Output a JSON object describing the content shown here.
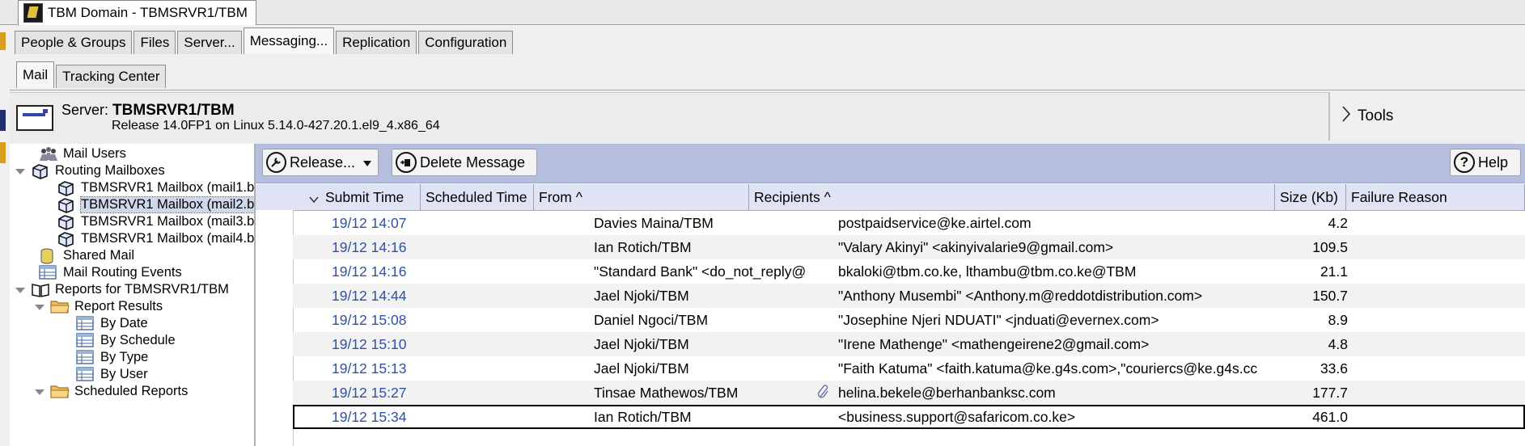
{
  "window_tab": {
    "title": "TBM Domain - TBMSRVR1/TBM"
  },
  "main_tabs": [
    {
      "label": "People & Groups",
      "active": false
    },
    {
      "label": "Files",
      "active": false
    },
    {
      "label": "Server...",
      "active": false
    },
    {
      "label": "Messaging...",
      "active": true
    },
    {
      "label": "Replication",
      "active": false
    },
    {
      "label": "Configuration",
      "active": false
    }
  ],
  "sub_tabs": [
    {
      "label": "Mail",
      "active": true
    },
    {
      "label": "Tracking Center",
      "active": false
    }
  ],
  "server": {
    "prefix": "Server:",
    "name": "TBMSRVR1/TBM",
    "release": "Release 14.0FP1 on Linux 5.14.0-427.20.1.el9_4.x86_64"
  },
  "tools": {
    "label": "Tools"
  },
  "nav": [
    {
      "label": "Mail Users",
      "icon": "users-icon",
      "twisty": "",
      "selected": false
    },
    {
      "label": "Routing Mailboxes",
      "icon": "mailbox-icon",
      "twisty": "open",
      "selected": false
    },
    {
      "label": "TBMSRVR1 Mailbox (mail1.b",
      "icon": "mailbox-icon",
      "twisty": "",
      "selected": false
    },
    {
      "label": "TBMSRVR1 Mailbox (mail2.b",
      "icon": "mailbox-icon",
      "twisty": "",
      "selected": true
    },
    {
      "label": "TBMSRVR1 Mailbox (mail3.b",
      "icon": "mailbox-icon",
      "twisty": "",
      "selected": false
    },
    {
      "label": "TBMSRVR1 Mailbox (mail4.b",
      "icon": "mailbox-icon",
      "twisty": "",
      "selected": false
    },
    {
      "label": "Shared Mail",
      "icon": "database-icon",
      "twisty": "",
      "selected": false
    },
    {
      "label": "Mail Routing Events",
      "icon": "view-icon",
      "twisty": "",
      "selected": false
    },
    {
      "label": "Reports for TBMSRVR1/TBM",
      "icon": "book-icon",
      "twisty": "open",
      "selected": false
    },
    {
      "label": "Report Results",
      "icon": "folder-icon",
      "twisty": "open",
      "selected": false
    },
    {
      "label": "By Date",
      "icon": "view-icon",
      "twisty": "",
      "selected": false
    },
    {
      "label": "By Schedule",
      "icon": "view-icon",
      "twisty": "",
      "selected": false
    },
    {
      "label": "By Type",
      "icon": "view-icon",
      "twisty": "",
      "selected": false
    },
    {
      "label": "By User",
      "icon": "view-icon",
      "twisty": "",
      "selected": false
    },
    {
      "label": "Scheduled Reports",
      "icon": "folder-icon",
      "twisty": "open",
      "selected": false
    }
  ],
  "actions": {
    "release": "Release...",
    "delete": "Delete Message",
    "help": "Help"
  },
  "columns": [
    "Submit Time",
    "Scheduled Time",
    "From ^",
    "Recipients ^",
    "Size (Kb)",
    "Failure Reason"
  ],
  "messages": [
    {
      "time": "19/12 14:07",
      "from": "Davies Maina/TBM",
      "recipients": "postpaidservice@ke.airtel.com",
      "size": "4.2",
      "attachment": false
    },
    {
      "time": "19/12 14:16",
      "from": "Ian Rotich/TBM",
      "recipients": "\"Valary Akinyi\" <akinyivalarie9@gmail.com>",
      "size": "109.5",
      "attachment": false
    },
    {
      "time": "19/12 14:16",
      "from": "\"Standard Bank\" <do_not_reply@",
      "recipients": "bkaloki@tbm.co.ke, lthambu@tbm.co.ke@TBM",
      "size": "21.1",
      "attachment": false
    },
    {
      "time": "19/12 14:44",
      "from": "Jael Njoki/TBM",
      "recipients": "\"Anthony Musembi\" <Anthony.m@reddotdistribution.com>",
      "size": "150.7",
      "attachment": false
    },
    {
      "time": "19/12 15:08",
      "from": "Daniel Ngoci/TBM",
      "recipients": "\"Josephine Njeri NDUATI\" <jnduati@evernex.com>",
      "size": "8.9",
      "attachment": false
    },
    {
      "time": "19/12 15:10",
      "from": "Jael Njoki/TBM",
      "recipients": "\"Irene Mathenge\" <mathengeirene2@gmail.com>",
      "size": "4.8",
      "attachment": false
    },
    {
      "time": "19/12 15:13",
      "from": "Jael Njoki/TBM",
      "recipients": "\"Faith Katuma\" <faith.katuma@ke.g4s.com>,\"couriercs@ke.g4s.cc",
      "size": "33.6",
      "attachment": false
    },
    {
      "time": "19/12 15:27",
      "from": "Tinsae Mathewos/TBM",
      "recipients": "helina.bekele@berhanbanksc.com",
      "size": "177.7",
      "attachment": true
    },
    {
      "time": "19/12 15:34",
      "from": "Ian Rotich/TBM",
      "recipients": "<business.support@safaricom.co.ke>",
      "size": "461.0",
      "attachment": false
    }
  ]
}
